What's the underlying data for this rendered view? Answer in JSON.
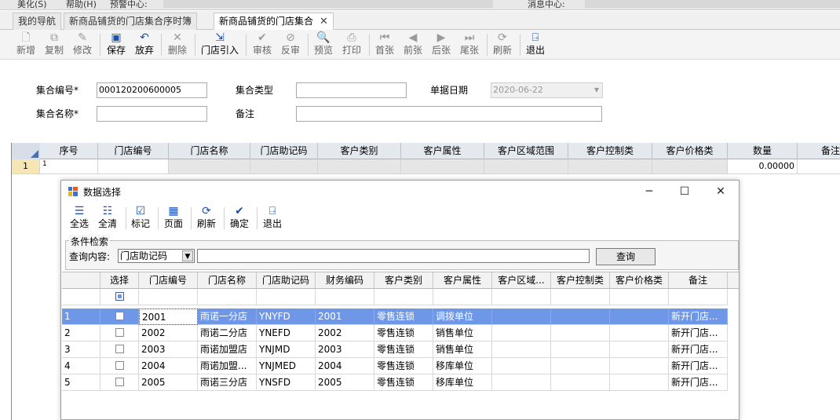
{
  "topbar": {
    "item1": "美化(S)",
    "item2": "帮助(H)",
    "item3": "预警中心:",
    "item4": "消息中心:"
  },
  "tabs": [
    {
      "label": "我的导航"
    },
    {
      "label": "新商品铺货的门店集合序时簿"
    },
    {
      "label": "新商品铺货的门店集合",
      "close": "✕"
    }
  ],
  "toolbar": {
    "new": "新增",
    "copy": "复制",
    "edit": "修改",
    "save": "保存",
    "discard": "放弃",
    "delete": "删除",
    "import": "门店引入",
    "audit": "审核",
    "unaudit": "反审",
    "preview": "预览",
    "print": "打印",
    "first": "首张",
    "prev": "前张",
    "next": "后张",
    "last": "尾张",
    "refresh": "刷新",
    "exit": "退出"
  },
  "form": {
    "code_label": "集合编号*",
    "code_value": "000120200600005",
    "type_label": "集合类型",
    "type_value": "",
    "date_label": "单据日期",
    "date_value": "2020-06-22",
    "name_label": "集合名称*",
    "name_value": "",
    "remark_label": "备注",
    "remark_value": ""
  },
  "main_grid": {
    "headers": [
      "序号",
      "门店编号",
      "门店名称",
      "门店助记码",
      "客户类别",
      "客户属性",
      "客户区域范围",
      "客户控制类",
      "客户价格类",
      "数量",
      "备注"
    ],
    "rows": [
      {
        "rownum": "1",
        "seq": "1",
        "qty": "0.00000"
      }
    ]
  },
  "dialog": {
    "title": "数据选择",
    "win_min": "─",
    "win_max": "☐",
    "win_close": "✕",
    "tools": {
      "select_all": "全选",
      "clear_all": "全清",
      "mark": "标记",
      "page": "页面",
      "refresh": "刷新",
      "ok": "确定",
      "exit": "退出"
    },
    "search": {
      "legend": "条件检索",
      "label": "查询内容:",
      "field": "门店助记码",
      "value": "",
      "button": "查询"
    },
    "headers": [
      "选择",
      "门店编号",
      "门店名称",
      "门店助记码",
      "财务编码",
      "客户类别",
      "客户属性",
      "客户区域...",
      "客户控制类",
      "客户价格类",
      "备注"
    ],
    "rows": [
      {
        "n": "1",
        "code": "2001",
        "name": "雨诺一分店",
        "mnemonic": "YNYFD",
        "fin": "2001",
        "category": "零售连锁",
        "attr": "调拨单位",
        "remark": "新开门店..."
      },
      {
        "n": "2",
        "code": "2002",
        "name": "雨诺二分店",
        "mnemonic": "YNEFD",
        "fin": "2002",
        "category": "零售连锁",
        "attr": "销售单位",
        "remark": "新开门店..."
      },
      {
        "n": "3",
        "code": "2003",
        "name": "雨诺加盟店",
        "mnemonic": "YNJMD",
        "fin": "2003",
        "category": "零售连锁",
        "attr": "销售单位",
        "remark": "新开门店..."
      },
      {
        "n": "4",
        "code": "2004",
        "name": "雨诺加盟...",
        "mnemonic": "YNJMED",
        "fin": "2004",
        "category": "零售连锁",
        "attr": "移库单位",
        "remark": "新开门店..."
      },
      {
        "n": "5",
        "code": "2005",
        "name": "雨诺三分店",
        "mnemonic": "YNSFD",
        "fin": "2005",
        "category": "零售连锁",
        "attr": "移库单位",
        "remark": "新开门店..."
      }
    ]
  },
  "colors": {
    "selection": "#6f97e8",
    "accent": "#1a4fb3"
  }
}
